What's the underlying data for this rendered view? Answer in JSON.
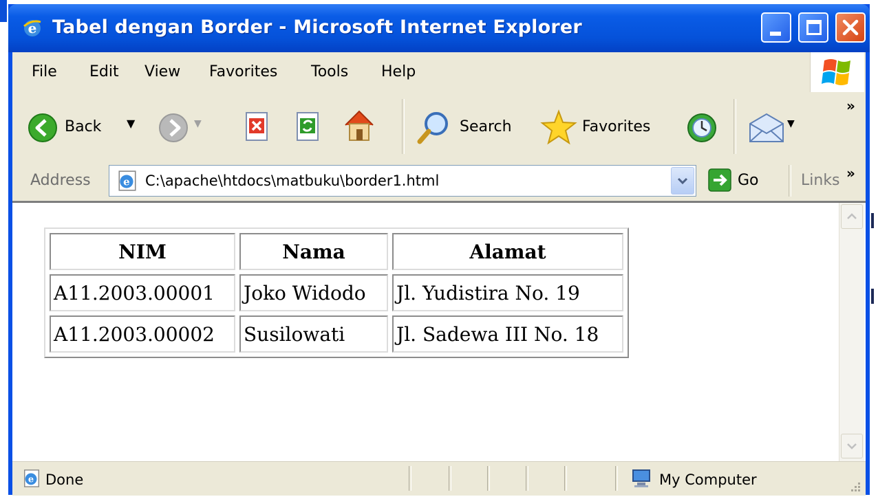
{
  "window": {
    "title": "Tabel dengan Border - Microsoft Internet Explorer"
  },
  "menu": {
    "items": [
      "File",
      "Edit",
      "View",
      "Favorites",
      "Tools",
      "Help"
    ]
  },
  "toolbar": {
    "back_label": "Back",
    "search_label": "Search",
    "favorites_label": "Favorites",
    "overflow": "»"
  },
  "address": {
    "label": "Address",
    "value": "C:\\apache\\htdocs\\matbuku\\border1.html",
    "go_label": "Go",
    "links_label": "Links",
    "overflow": "»"
  },
  "table": {
    "headers": [
      "NIM",
      "Nama",
      "Alamat"
    ],
    "rows": [
      [
        "A11.2003.00001",
        "Joko Widodo",
        "Jl. Yudistira No. 19"
      ],
      [
        "A11.2003.00002",
        "Susilowati",
        "Jl. Sadewa III No. 18"
      ]
    ]
  },
  "status": {
    "text": "Done",
    "zone": "My Computer"
  },
  "colors": {
    "titlebar": "#0a5ce6",
    "chrome": "#ece9d8",
    "close": "#d64414"
  }
}
